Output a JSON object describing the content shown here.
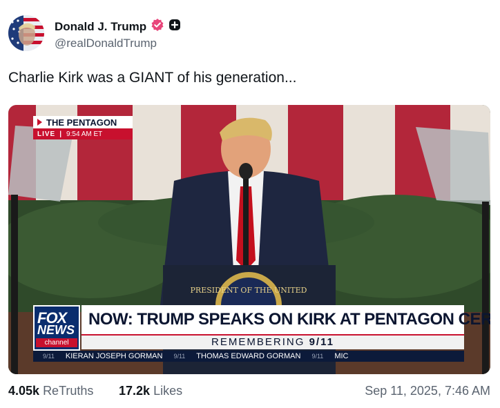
{
  "author": {
    "display_name": "Donald J. Trump",
    "handle": "@realDonaldTrump"
  },
  "post": {
    "text": "Charlie Kirk was a GIANT of his generation...",
    "stats": {
      "retruths_count": "4.05k",
      "retruths_label": "ReTruths",
      "likes_count": "17.2k",
      "likes_label": "Likes"
    },
    "timestamp": "Sep 11, 2025, 7:46 AM"
  },
  "video_overlay": {
    "bug_title": "THE PENTAGON",
    "bug_live": "LIVE",
    "bug_time": "9:54 AM ET",
    "logo_top": "FOX",
    "logo_bottom": "NEWS",
    "logo_channel": "channel",
    "headline": "NOW: TRUMP SPEAKS ON KIRK AT PENTAGON CEREMONY",
    "subhead_text": "REMEMBERING",
    "subhead_date": "9/11",
    "podium_seal_text": "PRESIDENT OF THE UNITED",
    "ticker": {
      "sep1": "9/11",
      "name1": "KIERAN JOSEPH GORMAN",
      "sep2": "9/11",
      "name2": "THOMAS EDWARD GORMAN",
      "sep3": "9/11",
      "name3": "MIC"
    }
  },
  "colors": {
    "brand_red": "#c8102e",
    "fox_blue": "#0a2d6e",
    "verified_pink": "#e8457a",
    "muted_text": "#5b6470"
  }
}
